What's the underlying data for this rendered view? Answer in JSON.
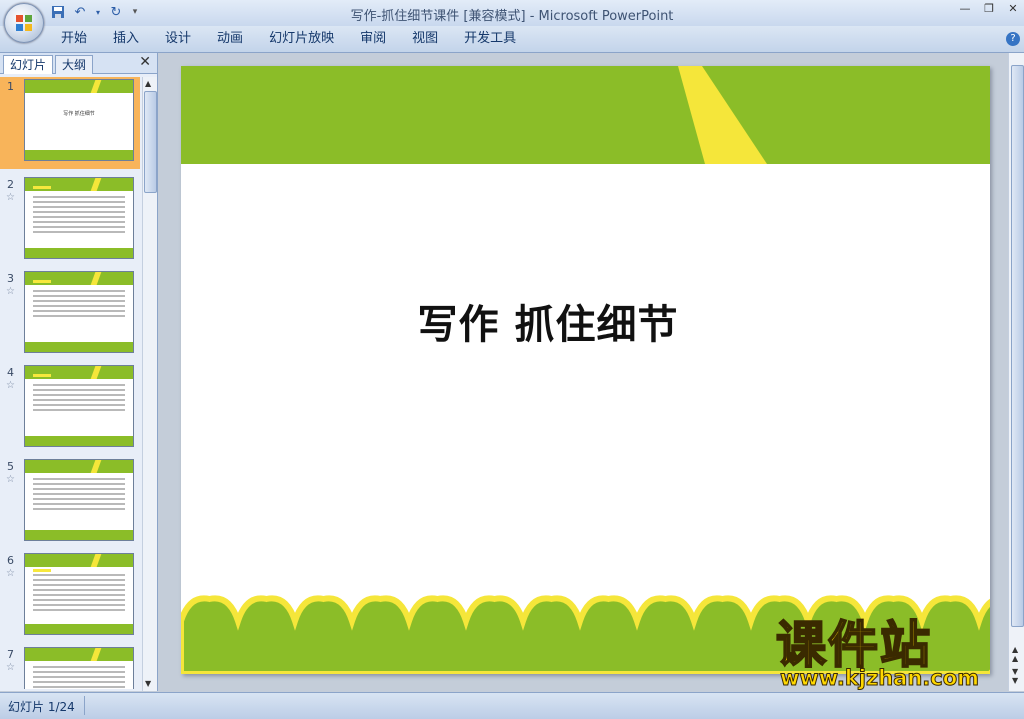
{
  "window": {
    "title_doc": "写作-抓住细节课件 [兼容模式]",
    "title_sep": " - ",
    "title_app": "Microsoft PowerPoint"
  },
  "ribbon": {
    "tabs": [
      "开始",
      "插入",
      "设计",
      "动画",
      "幻灯片放映",
      "审阅",
      "视图",
      "开发工具"
    ],
    "help": "?"
  },
  "left_pane": {
    "tab_slides": "幻灯片",
    "tab_outline": "大纲",
    "close": "✕",
    "slides": [
      {
        "num": "1",
        "label": "写作 抓住细节"
      },
      {
        "num": "2"
      },
      {
        "num": "3"
      },
      {
        "num": "4"
      },
      {
        "num": "5"
      },
      {
        "num": "6"
      },
      {
        "num": "7"
      }
    ]
  },
  "slide": {
    "title": "写作 抓住细节"
  },
  "status": {
    "slide_indicator": "幻灯片 1/24"
  },
  "watermark": {
    "big": "课件站",
    "url": "www.kjzhan.com"
  },
  "colors": {
    "accent_green": "#8bbd28",
    "accent_yellow": "#f5e63a",
    "selected_thumb": "#f8b45a"
  }
}
